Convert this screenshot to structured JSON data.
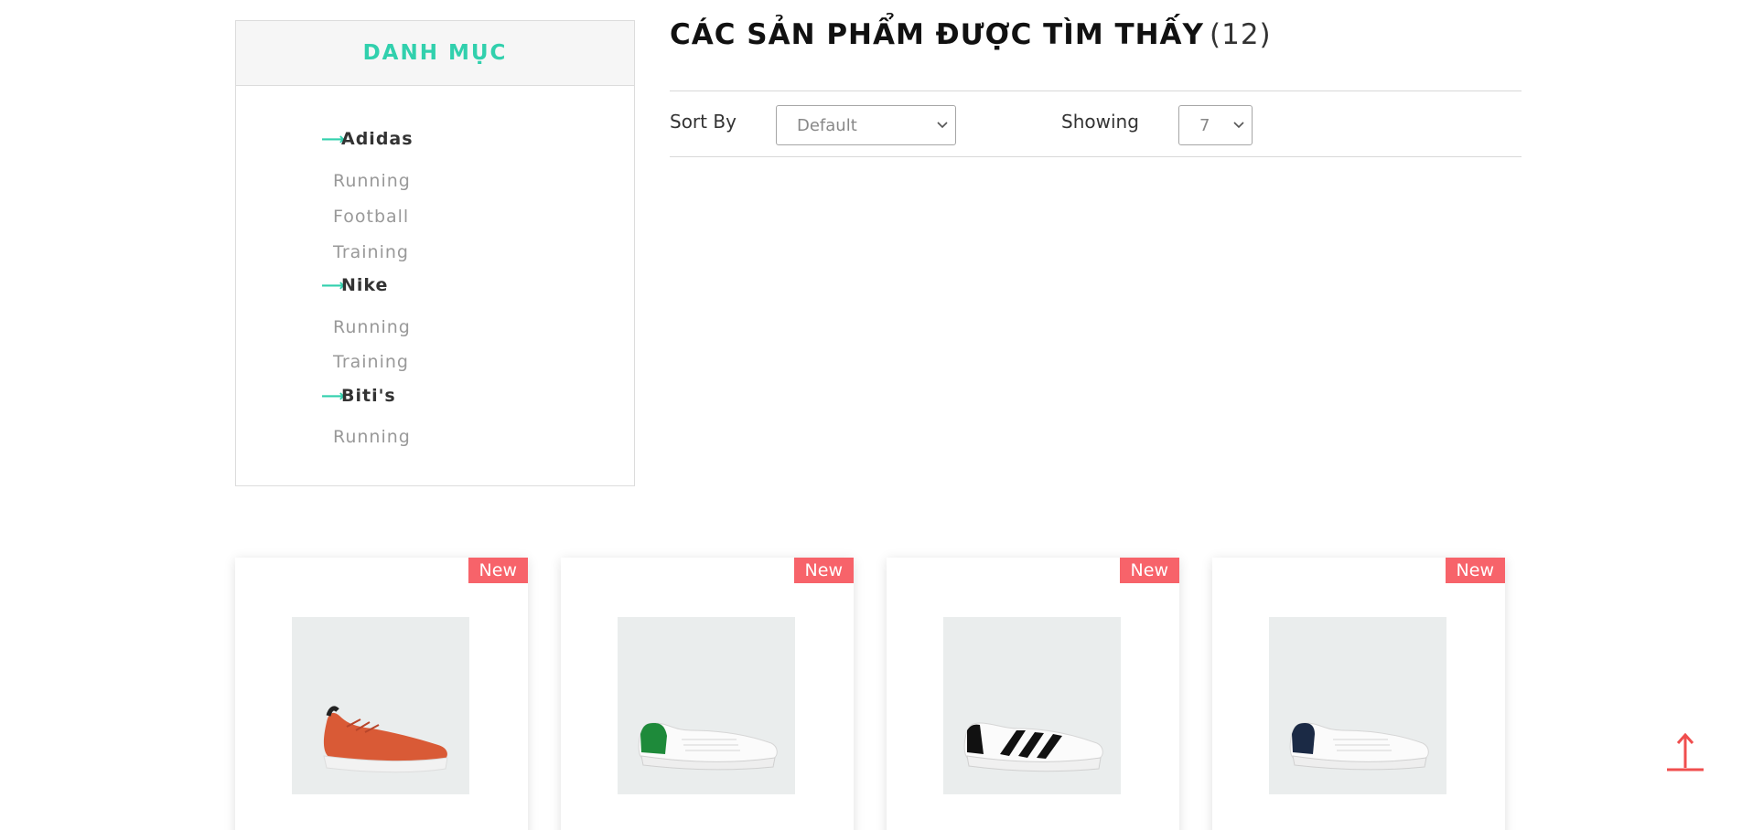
{
  "sidebar": {
    "title": "DANH MỤC",
    "brands": [
      {
        "label": "Adidas",
        "subs": [
          "Running",
          "Football",
          "Training"
        ]
      },
      {
        "label": "Nike",
        "subs": [
          "Running",
          "Training"
        ]
      },
      {
        "label": "Biti's",
        "subs": [
          "Running"
        ]
      }
    ]
  },
  "main": {
    "heading": "CÁC SẢN PHẨM ĐƯỢC TÌM THẤY",
    "count": "(12)",
    "sort_label": "Sort By",
    "sort_value": "Default",
    "showing_label": "Showing",
    "showing_value": "7"
  },
  "products": [
    {
      "badge": "New",
      "icon": "orange-runner-shoe-icon",
      "color": "#d95a36"
    },
    {
      "badge": "New",
      "icon": "white-green-sneaker-icon",
      "color": "#1e8a3a"
    },
    {
      "badge": "New",
      "icon": "white-black-stripes-sneaker-icon",
      "color": "#111111"
    },
    {
      "badge": "New",
      "icon": "white-navy-sneaker-icon",
      "color": "#1b2a45"
    }
  ],
  "colors": {
    "accent": "#31d0ad",
    "badge": "#f7636a"
  },
  "back_to_top_icon": "arrow-up-icon"
}
